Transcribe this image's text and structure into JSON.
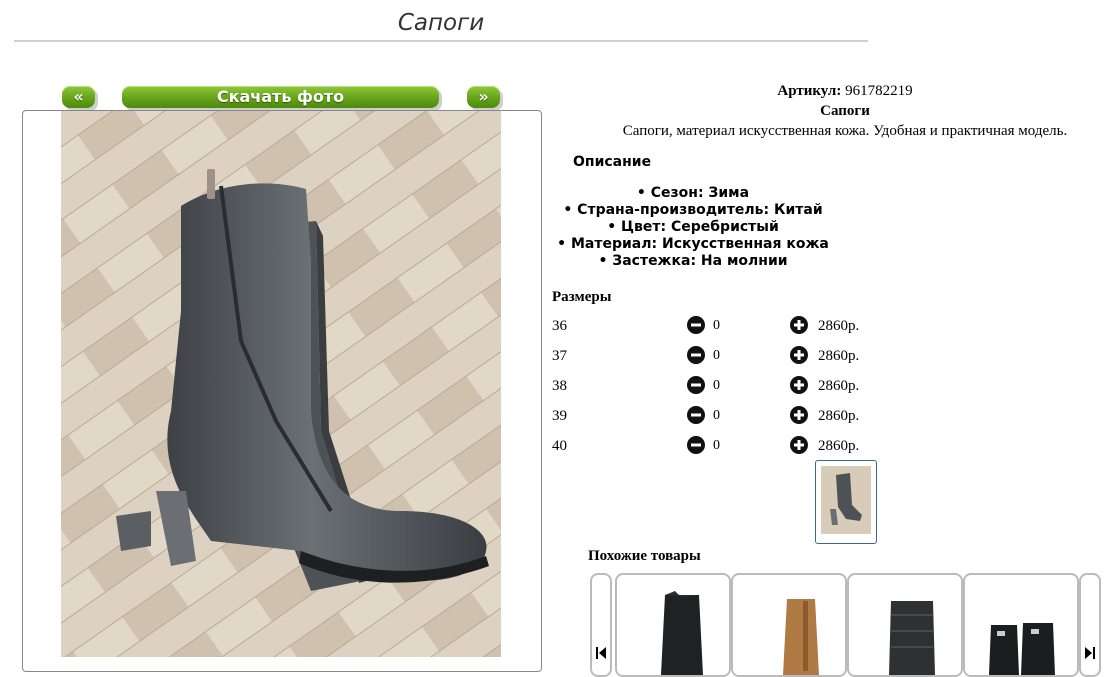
{
  "page": {
    "title": "Сапоги"
  },
  "gallery": {
    "prev_label": "«",
    "download_label": "Скачать фото",
    "next_label": "»"
  },
  "product": {
    "article_label": "Артикул:",
    "article_value": "961782219",
    "name": "Сапоги",
    "short_description": "Сапоги, материал искусственная кожа. Удобная и практичная модель."
  },
  "description": {
    "heading": "Описание",
    "properties": [
      "• Сезон: Зима",
      "• Страна-производитель: Китай",
      "• Цвет: Серебристый",
      "• Материал: Искусственная кожа",
      "• Застежка: На молнии"
    ]
  },
  "sizes": {
    "heading": "Размеры",
    "rows": [
      {
        "size": "36",
        "qty": "0",
        "price": "2860р."
      },
      {
        "size": "37",
        "qty": "0",
        "price": "2860р."
      },
      {
        "size": "38",
        "qty": "0",
        "price": "2860р."
      },
      {
        "size": "39",
        "qty": "0",
        "price": "2860р."
      },
      {
        "size": "40",
        "qty": "0",
        "price": "2860р."
      }
    ]
  },
  "similar": {
    "heading": "Похожие товары"
  },
  "icons": {
    "minus": "minus-circle-icon",
    "plus": "plus-circle-icon",
    "prev": "skip-back-icon",
    "next": "skip-forward-icon"
  },
  "colors": {
    "button_green": "#6aa61c",
    "boot": "#55595d",
    "floor": "#d6c9b6"
  }
}
